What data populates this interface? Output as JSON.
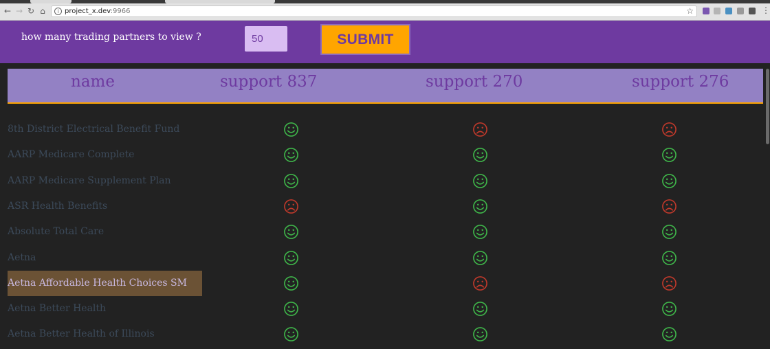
{
  "browser": {
    "url_host": "project_x.dev",
    "url_port": ":9966"
  },
  "form": {
    "question": "how many trading partners to view ?",
    "count_value": "50",
    "submit_label": "SUBMIT"
  },
  "table": {
    "headers": [
      "name",
      "support 837",
      "support 270",
      "support 276"
    ],
    "rows": [
      {
        "name": "8th District Electrical Benefit Fund",
        "support": [
          true,
          false,
          false
        ]
      },
      {
        "name": "AARP Medicare Complete",
        "support": [
          true,
          true,
          true
        ]
      },
      {
        "name": "AARP Medicare Supplement Plan",
        "support": [
          true,
          true,
          true
        ]
      },
      {
        "name": "ASR Health Benefits",
        "support": [
          false,
          true,
          false
        ]
      },
      {
        "name": "Absolute Total Care",
        "support": [
          true,
          true,
          true
        ]
      },
      {
        "name": "Aetna",
        "support": [
          true,
          true,
          true
        ]
      },
      {
        "name": "Aetna Affordable Health Choices SM",
        "support": [
          true,
          false,
          false
        ],
        "highlighted": true
      },
      {
        "name": "Aetna Better Health",
        "support": [
          true,
          true,
          true
        ]
      },
      {
        "name": "Aetna Better Health of Illinois",
        "support": [
          true,
          true,
          true
        ]
      }
    ]
  },
  "colors": {
    "purple": "#6e3aa0",
    "orange": "#ffa500",
    "header_bg": "#9381c4",
    "smile": "#3fb64a",
    "frown": "#c0392b"
  }
}
